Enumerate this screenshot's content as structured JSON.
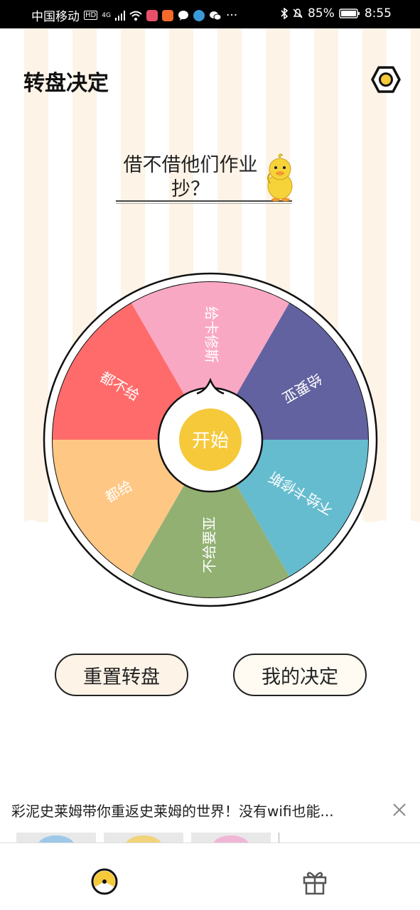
{
  "status_bar": {
    "carrier": "中国移动",
    "hd": "HD",
    "network": "4G",
    "battery_percent": "85%",
    "time": "8:55",
    "more": "···"
  },
  "header": {
    "title": "转盘决定",
    "settings_icon": "settings-gear-icon"
  },
  "question": {
    "text": "借不借他们作业抄？",
    "mascot": "yellow-duck"
  },
  "wheel": {
    "start_label": "开始",
    "segments": [
      {
        "label": "给卡修斯",
        "color": "#F9A8C4"
      },
      {
        "label": "给要亚",
        "color": "#6262A0"
      },
      {
        "label": "不给卡修斯",
        "color": "#66BCCF"
      },
      {
        "label": "不给要亚",
        "color": "#92B072"
      },
      {
        "label": "都给",
        "color": "#FFC784"
      },
      {
        "label": "都不给",
        "color": "#FF6B6B"
      }
    ]
  },
  "buttons": {
    "reset": "重置转盘",
    "my_decision": "我的决定"
  },
  "ad": {
    "text": "彩泥史莱姆带你重返史莱姆的世界！没有wifi也能...",
    "close_icon": "close-icon"
  },
  "tab_bar": {
    "tabs": [
      {
        "name": "wheel-tab",
        "icon": "wheel-icon"
      },
      {
        "name": "gift-tab",
        "icon": "gift-icon"
      }
    ]
  },
  "colors": {
    "accent": "#F5C93A",
    "stripe": "#FDF3E7",
    "button_bg": "#FDF3E7"
  }
}
